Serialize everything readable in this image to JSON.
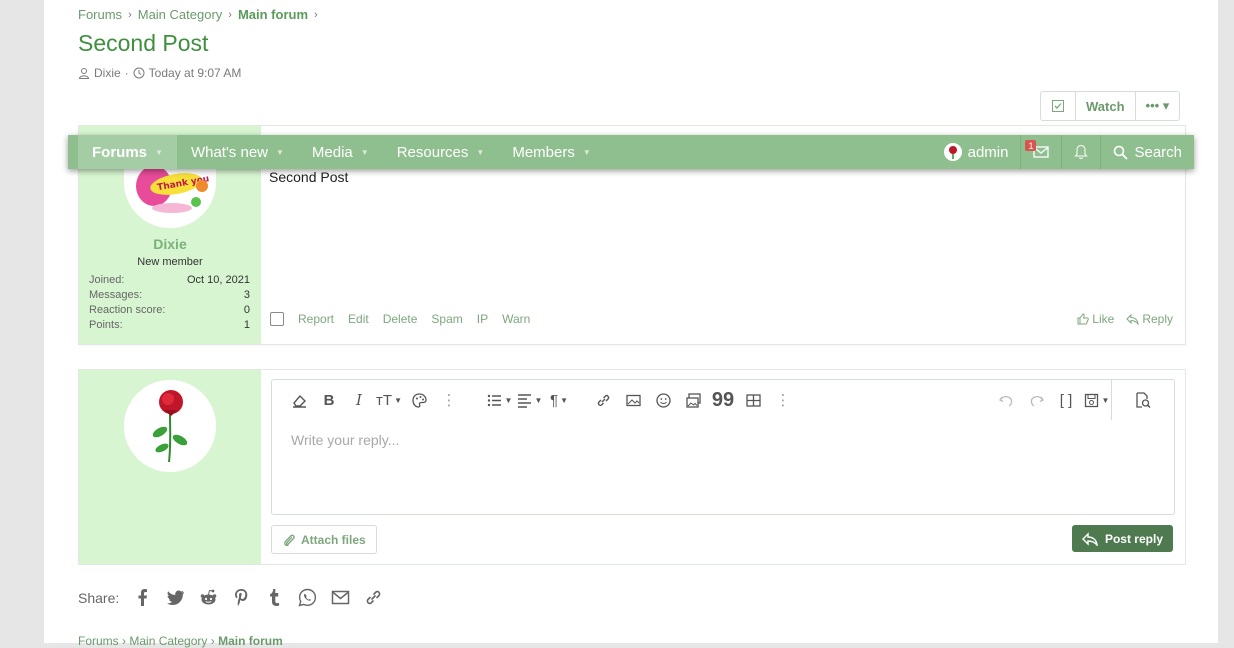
{
  "breadcrumb": {
    "items": [
      "Forums",
      "Main Category",
      "Main forum"
    ]
  },
  "thread": {
    "title": "Second Post",
    "author": "Dixie",
    "date": "Today at 9:07 AM",
    "watch_label": "Watch",
    "more_label": "••• ▾"
  },
  "nav": {
    "items": [
      "Forums",
      "What's new",
      "Media",
      "Resources",
      "Members"
    ],
    "user": "admin",
    "inbox_badge": "1",
    "search_label": "Search"
  },
  "post": {
    "username": "Dixie",
    "user_title": "New member",
    "avatar_text": "Thank you",
    "stats": [
      {
        "label": "Joined:",
        "value": "Oct 10, 2021"
      },
      {
        "label": "Messages:",
        "value": "3"
      },
      {
        "label": "Reaction score:",
        "value": "0"
      },
      {
        "label": "Points:",
        "value": "1"
      }
    ],
    "body": "Second Post",
    "actions": [
      "Report",
      "Edit",
      "Delete",
      "Spam",
      "IP",
      "Warn"
    ],
    "like_label": "Like",
    "reply_label": "Reply"
  },
  "editor": {
    "placeholder": "Write your reply...",
    "attach_label": "Attach files",
    "post_reply_label": "Post reply"
  },
  "share": {
    "label": "Share:",
    "icons": [
      "facebook-icon",
      "twitter-icon",
      "reddit-icon",
      "pinterest-icon",
      "tumblr-icon",
      "whatsapp-icon",
      "email-icon",
      "link-icon"
    ]
  },
  "colors": {
    "accent": "#8fbf8f",
    "user_panel": "#d8f5d1",
    "title": "#3f8f3f",
    "button_dark": "#4f7a4f"
  }
}
